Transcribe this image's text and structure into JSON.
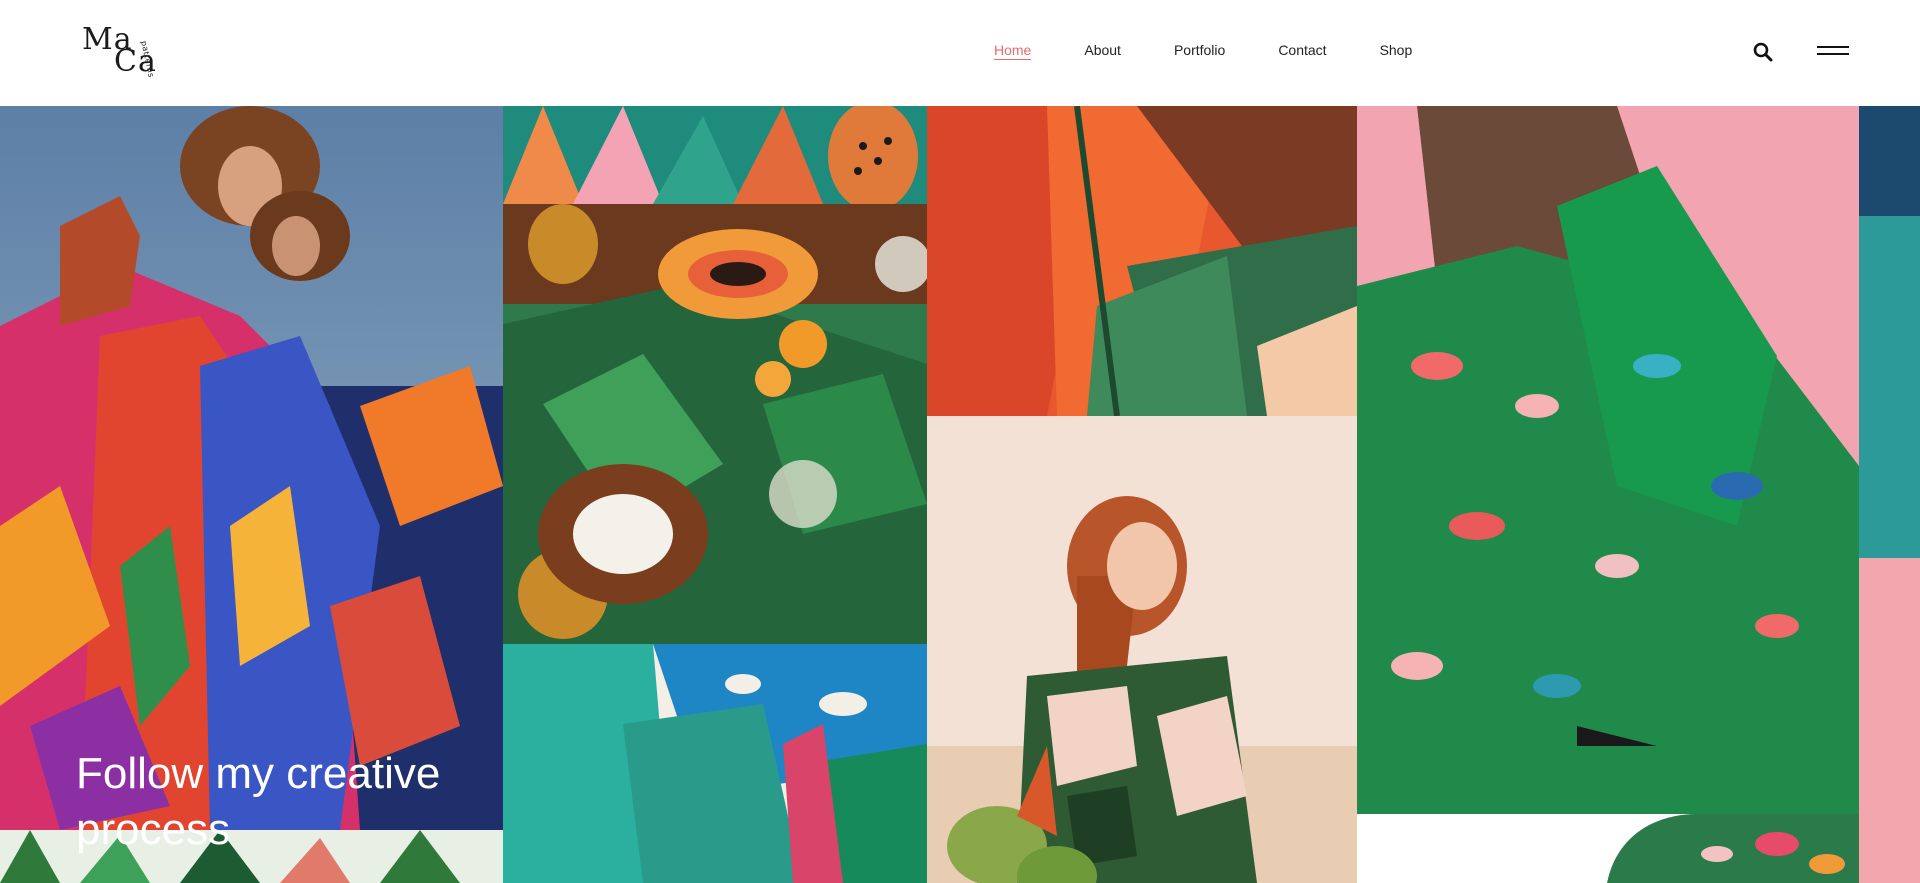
{
  "logo": {
    "line1": "Ma",
    "line2": "Ca",
    "sub": "patterns"
  },
  "nav": [
    {
      "label": "Home",
      "active": true
    },
    {
      "label": "About",
      "active": false
    },
    {
      "label": "Portfolio",
      "active": false
    },
    {
      "label": "Contact",
      "active": false
    },
    {
      "label": "Shop",
      "active": false
    }
  ],
  "icons": {
    "search": "search-icon",
    "menu": "hamburger-menu-icon"
  },
  "hero": {
    "headline": "Follow my creative process"
  },
  "colors": {
    "accent": "#e86a6a",
    "navy": "#1c4a6e",
    "teal": "#2c9a98",
    "pink": "#f2a6ae"
  }
}
